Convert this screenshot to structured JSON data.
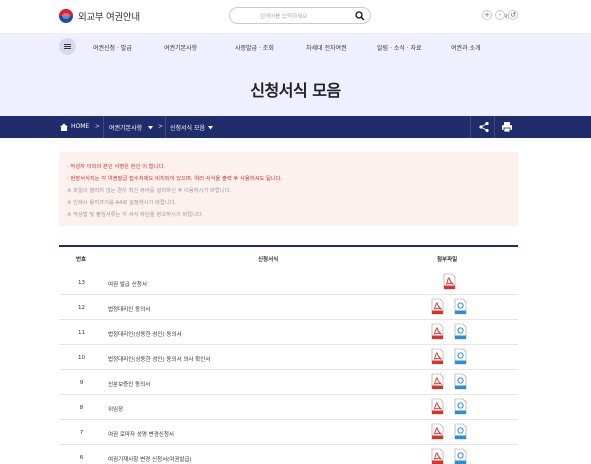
{
  "header": {
    "logo_text": "외교부 여권안내",
    "search_placeholder": "검색어를 입력하세요",
    "util_text": "글자크기",
    "zoom_in": "+",
    "zoom_out": "-",
    "zoom_reset": "↺"
  },
  "gnb": {
    "items": [
      {
        "label": "여권신청 · 발급"
      },
      {
        "label": "여권기본사항"
      },
      {
        "label": "사증발급 · 조회"
      },
      {
        "label": "차세대 전자여권"
      },
      {
        "label": "알림 · 소식 · 자료"
      },
      {
        "label": "여권과 소개"
      }
    ]
  },
  "hero": {
    "title": "신청서식 모음"
  },
  "breadcrumb": {
    "home": "HOME",
    "level1": "여권기본사항",
    "level2": "신청서식 모음",
    "separator": ">"
  },
  "notice": {
    "lines": [
      "· 작성자 이외의 본인 서명은 본인 이 합니다.",
      "· 현장서식지는 각 여권발급 접수처에도 비치되어 있으며, 여러 서식을 출력 후 사용하셔도 됩니다.",
      "※ 파일이 열리지 않는 경우 최신 뷰어를 설치하신 후 이용하시기 바랍니다.",
      "※ 인쇄시 용지크기를 A4로 설정하시기 바랍니다.",
      "※ 작성법 및 붙임서류는 각 서식 하단을 참고하시기 바랍니다."
    ]
  },
  "table": {
    "headers": {
      "num": "번호",
      "title": "신청서식",
      "files": "첨부파일"
    },
    "rows": [
      {
        "num": "13",
        "title": "여권 발급 신청서",
        "pdf": true,
        "hwp": false
      },
      {
        "num": "12",
        "title": "법정대리인 동의서",
        "pdf": true,
        "hwp": true
      },
      {
        "num": "11",
        "title": "법정대리인(상동한 성인) 동의서",
        "pdf": true,
        "hwp": true
      },
      {
        "num": "10",
        "title": "법정대리인(상동한 성인) 동의서 의사 확인서",
        "pdf": true,
        "hwp": true
      },
      {
        "num": "9",
        "title": "신분보증인 동의서",
        "pdf": true,
        "hwp": true
      },
      {
        "num": "8",
        "title": "위임장",
        "pdf": true,
        "hwp": true
      },
      {
        "num": "7",
        "title": "여권 로마자 성명 변경신청서",
        "pdf": true,
        "hwp": true
      },
      {
        "num": "6",
        "title": "여권기재사항 변경 신청서(여권발급)",
        "pdf": true,
        "hwp": true
      }
    ]
  },
  "colors": {
    "navy": "#1f2d6b",
    "lavender": "#eef0ff",
    "notice_bg": "#fdf1ee",
    "notice_red": "#d3302b",
    "pdf_red": "#d9312b",
    "hwp_blue": "#2c8fd6"
  },
  "icons": {
    "search": "search-icon",
    "menu": "hamburger-icon",
    "home": "home-icon",
    "share": "share-icon",
    "print": "print-icon",
    "pdf": "pdf-file-icon",
    "hwp": "hwp-file-icon"
  }
}
